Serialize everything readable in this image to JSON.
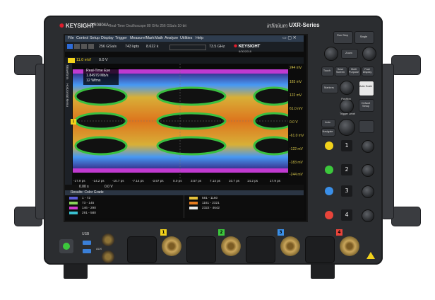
{
  "brand": {
    "logo": "KEYSIGHT",
    "model": "UXR0804A",
    "description": "Real-Time Oscilloscope  80 GHz  256 GSa/s  10-bit",
    "family": "infiniium",
    "series": "UXR-Series"
  },
  "menu": [
    "File",
    "Control",
    "Setup",
    "Display",
    "Trigger",
    "Measure/Mark",
    "Math",
    "Analyze",
    "Utilities",
    "Help"
  ],
  "toolbar": {
    "sample_rate": "256 GSa/s",
    "memory": "743 kpts",
    "timebase": "8.622 k",
    "bandwidth": "73.5 GHz",
    "logo": "KEYSIGHT",
    "date": "6/30/2018"
  },
  "wave_toolbar": {
    "scale": "11.0 mV/",
    "offset": "0.0 V"
  },
  "sidebar_tabs": [
    "Waveform",
    "Horizontal Menu"
  ],
  "eye_info": {
    "title": "Real-Time Eye",
    "rate": "1.84979 Mb/s",
    "count": "12 Wfms"
  },
  "y_axis": [
    "244 mV",
    "183 mV",
    "122 mV",
    "61.0 mV",
    "0.0 V",
    "-61.0 mV",
    "-122 mV",
    "-183 mV",
    "-244 mV"
  ],
  "x_axis": [
    "-17.9 ps",
    "-14.2 ps",
    "-10.7 ps",
    "-7.14 ps",
    "-3.57 ps",
    "0.0 ps",
    "3.57 ps",
    "7.14 ps",
    "10.7 ps",
    "14.2 ps",
    "17.9 ps"
  ],
  "meas_row": {
    "left": "0.00 s",
    "right": "0.0 V"
  },
  "results": {
    "title": "Results: Color Grade",
    "legend_left": [
      {
        "range": "1 - 72",
        "color": "#5a5cd8"
      },
      {
        "range": "73 - 145",
        "color": "#8ad05a"
      },
      {
        "range": "146 - 290",
        "color": "#d03ad0"
      },
      {
        "range": "291 - 580",
        "color": "#3ac0d0"
      }
    ],
    "legend_right": [
      {
        "range": "581 - 1160",
        "color": "#e3c03a"
      },
      {
        "range": "1161 - 2321",
        "color": "#e37a1e"
      },
      {
        "range": "2322 - 4642",
        "color": "#e8e8e8"
      }
    ]
  },
  "right_panel": {
    "run_stop": "Run Stop",
    "single": "Single",
    "zoom": "Zoom",
    "buttons_row1": [
      "Touch",
      "Save Screen",
      "Multi Purpose",
      "Fast Display"
    ],
    "markers": "Markers",
    "auto_scale": "Auto Scale",
    "position": "Position",
    "default_setup": "Default Setup",
    "trigger_level": "Trigger Level",
    "auto": "Auto",
    "navigate": "Navigate",
    "channels": [
      "1",
      "2",
      "3",
      "4"
    ]
  },
  "bottom": {
    "ports_top": "3",
    "ports_sub": "USB",
    "bnc_aux_in": "AUX",
    "channel_labels": [
      "1",
      "2",
      "3",
      "4"
    ]
  },
  "colors": {
    "ch1": "#f2d21b",
    "ch2": "#3cc83c",
    "ch3": "#3a8fe8",
    "ch4": "#e8443a",
    "accent": "#e21d2d"
  }
}
